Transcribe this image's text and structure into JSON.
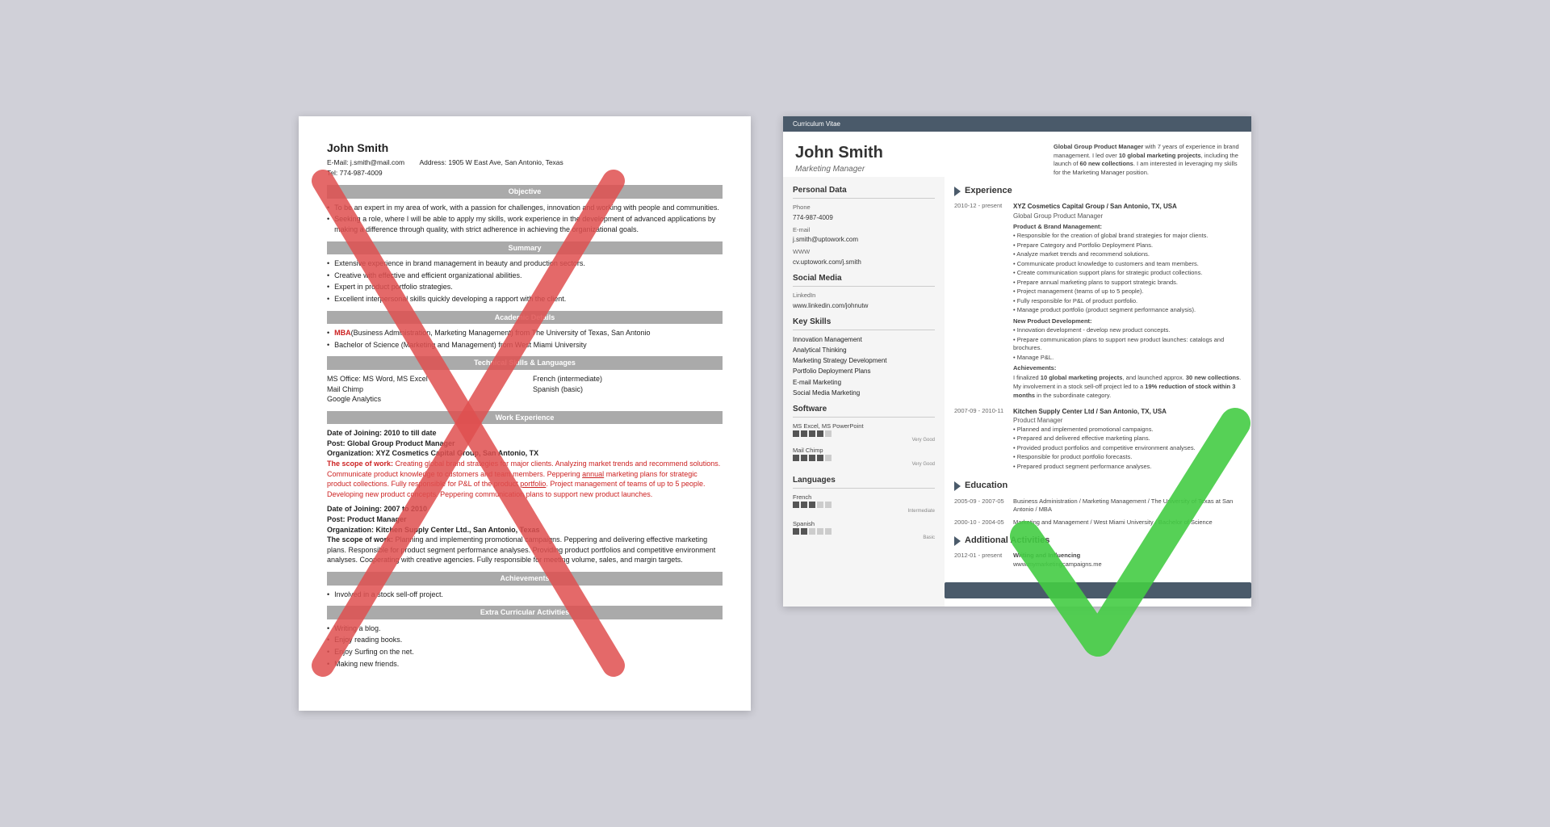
{
  "left_resume": {
    "name": "John Smith",
    "email_label": "E-Mail:",
    "email": "j.smith@mail.com",
    "address_label": "Address:",
    "address": "1905 W East Ave, San Antonio, Texas",
    "tel_label": "Tel:",
    "tel": "774-987-4009",
    "sections": {
      "objective": {
        "title": "Objective",
        "bullets": [
          "To be an expert in my area of work, with a passion for challenges, innovation and working with people and communities.",
          "Seeking a role, where I will be able to apply my skills, work experience in the development of advanced applications by making a difference through quality, with strict adherence in achieving the organizational goals."
        ]
      },
      "summary": {
        "title": "Summary",
        "bullets": [
          "Extensive experience in brand management in beauty and production sectors.",
          "Creative with effective and efficient organizational abilities.",
          "Expert in product portfolio strategies.",
          "Excellent interpersonal skills quickly developing a rapport with the client."
        ]
      },
      "academic": {
        "title": "Academic Details",
        "bullets": [
          "MBA (Business Administration, Marketing Management) from The University of Texas, San Antonio",
          "Bachelor of Science (Marketing and Management) from West Miami University"
        ]
      },
      "technical": {
        "title": "Technical Skills & Languages",
        "col1": [
          "MS Office: MS Word, MS Excel",
          "Mail Chimp",
          "Google Analytics"
        ],
        "col2": [
          "French (intermediate)",
          "Spanish (basic)"
        ]
      },
      "work": {
        "title": "Work Experience",
        "jobs": [
          {
            "date": "Date of Joining: 2010 to till date",
            "post": "Post: Global Group Product Manager",
            "org": "Organization: XYZ Cosmetics Capital Group, San Antonio, TX",
            "scope_label": "The scope of work:",
            "scope": "Creating global brand strategies for major clients. Analyzing market trends and recommend solutions. Communicate product knowledge to customers and team members. Peppering annual marketing plans for strategic product collections. Fully responsible for P&L of the product portfolio. Project management of teams of up to 5 people. Developing new product concepts. Peppering communication plans to support new product launches."
          },
          {
            "date": "Date of Joining: 2007 to 2010",
            "post": "Post: Product Manager",
            "org": "Organization: Kitchen Supply Center Ltd., San Antonio, Texas",
            "scope_label": "The scope of work:",
            "scope": "Planning and implementing promotional campaigns. Peppering and delivering effective marketing plans. Responsible for product segment performance analyses. Providing product portfolios and competitive environment analyses. Cooperating with creative agencies. Fully responsible for meeting volume, sales, and margin targets."
          }
        ]
      },
      "achievements": {
        "title": "Achievements",
        "bullets": [
          "Involved in a stock sell-off project."
        ]
      },
      "extracurricular": {
        "title": "Extra Curricular Activities",
        "bullets": [
          "Writing a blog.",
          "Enjoy reading books.",
          "Enjoy Surfing on the net.",
          "Making new friends."
        ]
      }
    }
  },
  "right_resume": {
    "cv_label": "Curriculum Vitae",
    "name": "John Smith",
    "title": "Marketing Manager",
    "intro": "Global Group Product Manager with 7 years of experience in brand management. I led over 10 global marketing projects, including the launch of 60 new collections. I am interested in leveraging my skills for the Marketing Manager position.",
    "personal_data": {
      "section_title": "Personal Data",
      "phone_label": "Phone",
      "phone": "774-987-4009",
      "email_label": "E-mail",
      "email": "j.smith@uptowork.com",
      "www_label": "WWW",
      "www": "cv.uptowork.com/j.smith"
    },
    "social_media": {
      "section_title": "Social Media",
      "linkedin_label": "LinkedIn",
      "linkedin": "www.linkedin.com/johnutw"
    },
    "key_skills": {
      "section_title": "Key Skills",
      "skills": [
        "Innovation Management",
        "Analytical Thinking",
        "Marketing Strategy Development",
        "Portfolio Deployment Plans",
        "E-mail Marketing",
        "Social Media Marketing"
      ]
    },
    "software": {
      "section_title": "Software",
      "items": [
        {
          "name": "MS Excel, MS PowerPoint",
          "filled": 4,
          "empty": 1,
          "level": "Very Good"
        },
        {
          "name": "Mail Chimp",
          "filled": 4,
          "empty": 1,
          "level": "Very Good"
        }
      ]
    },
    "languages": {
      "section_title": "Languages",
      "items": [
        {
          "name": "French",
          "filled": 3,
          "empty": 2,
          "level": "Intermediate"
        },
        {
          "name": "Spanish",
          "filled": 2,
          "empty": 3,
          "level": "Basic"
        }
      ]
    },
    "experience": {
      "section_title": "Experience",
      "jobs": [
        {
          "dates": "2010-12 - present",
          "company": "XYZ Cosmetics Capital Group / San Antonio, TX, USA",
          "role": "Global Group Product Manager",
          "subsections": [
            {
              "heading": "Product & Brand Management:",
              "bullets": [
                "Responsible for the creation of global brand strategies for major clients.",
                "Prepare Category and Portfolio Deployment Plans.",
                "Analyze market trends and recommend solutions.",
                "Communicate product knowledge to customers and team members.",
                "Create communication support plans for strategic product collections.",
                "Prepare annual marketing plans to support strategic brands.",
                "Project management (teams of up to 5 people).",
                "Fully responsible for P&L of product portfolio.",
                "Manage product portfolio (product segment performance analysis)."
              ]
            },
            {
              "heading": "New Product Development:",
              "bullets": [
                "Innovation development - develop new product concepts.",
                "Prepare communication plans to support new product launches: catalogs and brochures.",
                "Manage P&L."
              ]
            },
            {
              "heading": "Achievements:",
              "text": "I finalized 10 global marketing projects, and launched approx. 30 new collections.\nMy involvement in a stock sell-off project led to a 19% reduction of stock within 3 months in the subordinate category."
            }
          ]
        },
        {
          "dates": "2007-09 - 2010-11",
          "company": "Kitchen Supply Center Ltd / San Antonio, TX, USA",
          "role": "Product Manager",
          "bullets": [
            "Planned and implemented promotional campaigns.",
            "Prepared and delivered effective marketing plans.",
            "Provided product portfolios and competitive environment analyses.",
            "Responsible for product portfolio forecasts.",
            "Prepared product segment performance analyses."
          ]
        }
      ]
    },
    "education": {
      "section_title": "Education",
      "entries": [
        {
          "dates": "2005-09 - 2007-05",
          "text": "Business Administration / Marketing Management / The University of Texas at San Antonio / MBA"
        },
        {
          "dates": "2000-10 - 2004-05",
          "text": "Marketing and Management / West Miami University / Bachelor of Science"
        }
      ]
    },
    "additional": {
      "section_title": "Additional Activities",
      "entries": [
        {
          "dates": "2012-01 - present",
          "heading": "Writing and Influencing",
          "text": "www.mymarketingcampaigns.me"
        }
      ]
    }
  },
  "x_color": "#e05050",
  "check_color": "#44cc44"
}
